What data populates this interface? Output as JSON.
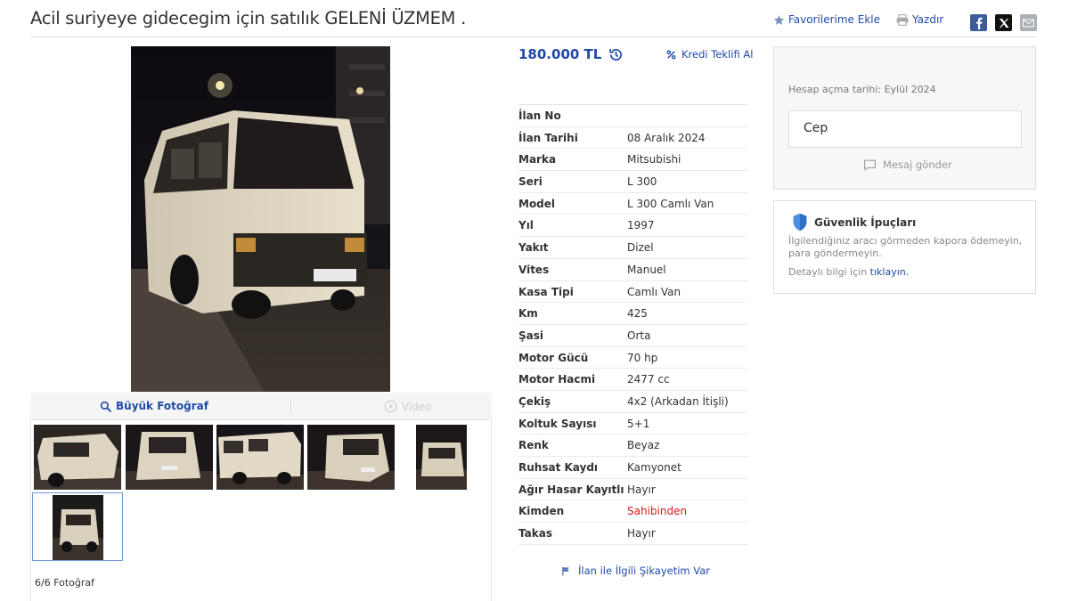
{
  "listing": {
    "title": "Acil suriyeye gidecegim için satılık GELENİ ÜZMEM ."
  },
  "header_actions": {
    "favorites_label": "Favorilerime Ekle",
    "print_label": "Yazdır",
    "share_icons": [
      "facebook-icon",
      "x-icon",
      "mail-icon"
    ]
  },
  "price": {
    "value": "180.000 TL",
    "history_icon": "price-history-icon",
    "loan_label": "Kredi Teklifi Al"
  },
  "photos": {
    "big_photo_label": "Büyük Fotoğraf",
    "video_label": "Video",
    "counter": "6/6 Fotoğraf",
    "thumbnail_count": 6,
    "active_thumbnail": 6
  },
  "specs": [
    {
      "label": "İlan No",
      "value": ""
    },
    {
      "label": "İlan Tarihi",
      "value": "08 Aralık 2024"
    },
    {
      "label": "Marka",
      "value": "Mitsubishi"
    },
    {
      "label": "Seri",
      "value": "L 300"
    },
    {
      "label": "Model",
      "value": "L 300 Camlı Van"
    },
    {
      "label": "Yıl",
      "value": "1997"
    },
    {
      "label": "Yakıt",
      "value": "Dizel"
    },
    {
      "label": "Vites",
      "value": "Manuel"
    },
    {
      "label": "Kasa Tipi",
      "value": "Camlı Van"
    },
    {
      "label": "Km",
      "value": "425"
    },
    {
      "label": "Şasi",
      "value": "Orta"
    },
    {
      "label": "Motor Gücü",
      "value": "70 hp"
    },
    {
      "label": "Motor Hacmi",
      "value": "2477 cc"
    },
    {
      "label": "Çekiş",
      "value": "4x2 (Arkadan İtişli)"
    },
    {
      "label": "Koltuk Sayısı",
      "value": "5+1"
    },
    {
      "label": "Renk",
      "value": "Beyaz"
    },
    {
      "label": "Ruhsat Kaydı",
      "value": "Kamyonet"
    },
    {
      "label": "Ağır Hasar Kayıtlı",
      "value": "Hayır"
    },
    {
      "label": "Kimden",
      "value": "Sahibinden",
      "highlight": true
    },
    {
      "label": "Takas",
      "value": "Hayır"
    }
  ],
  "complaint_label": "İlan ile İlgili Şikayetim Var",
  "seller_panel": {
    "account_opened": "Hesap açma tarihi: Eylül 2024",
    "phone_label": "Cep",
    "message_label": "Mesaj gönder"
  },
  "safety_panel": {
    "heading": "Güvenlik İpuçları",
    "text": "İlgilendiğiniz aracı görmeden kapora ödemeyin, para göndermeyin.",
    "detail_prefix": "Detaylı bilgi için",
    "detail_link": "tıklayın."
  },
  "colors": {
    "link_blue": "#1f4aa8",
    "alert_red": "#d71818"
  }
}
